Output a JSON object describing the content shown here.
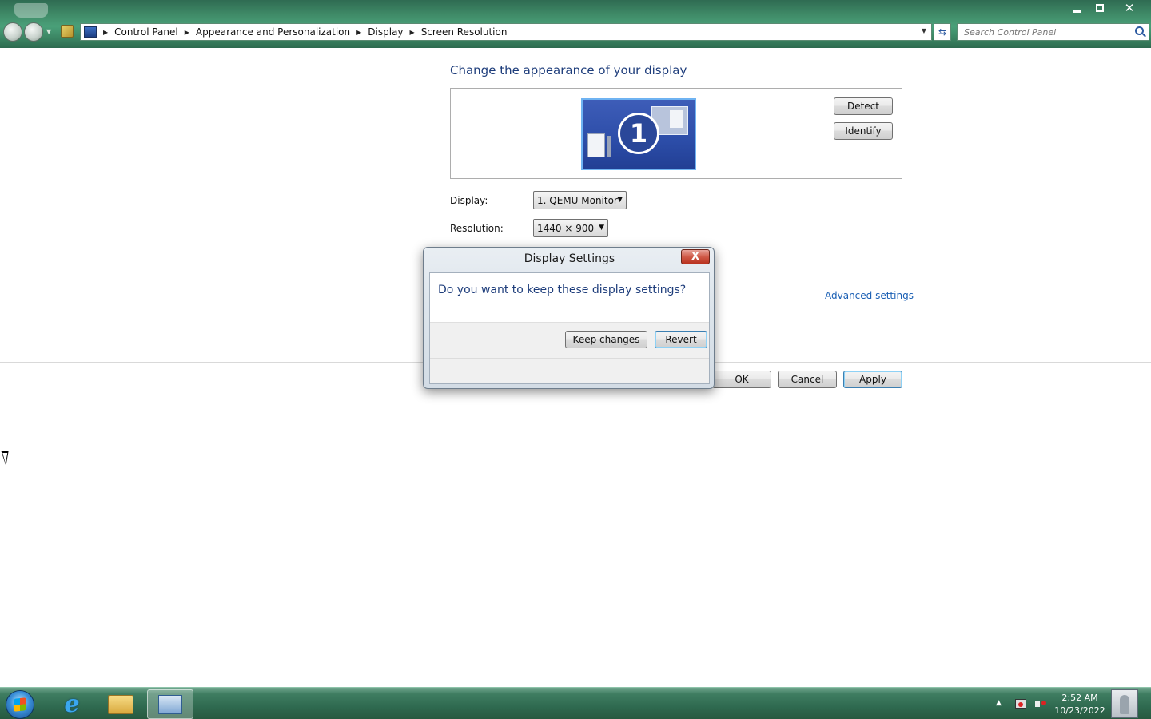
{
  "window": {
    "title": "Screen Resolution",
    "controls": {
      "minimize": "minimize",
      "maximize": "maximize",
      "close": "close"
    }
  },
  "address_bar": {
    "breadcrumbs": [
      "Control Panel",
      "Appearance and Personalization",
      "Display",
      "Screen Resolution"
    ]
  },
  "search": {
    "placeholder": "Search Control Panel"
  },
  "main": {
    "title": "Change the appearance of your display",
    "monitor_number": "1",
    "detect_label": "Detect",
    "identify_label": "Identify",
    "display_label": "Display:",
    "display_value": "1. QEMU Monitor",
    "resolution_label": "Resolution:",
    "resolution_value": "1440 × 900",
    "advanced_link": "Advanced settings",
    "ok_label": "OK",
    "cancel_label": "Cancel",
    "apply_label": "Apply"
  },
  "dialog": {
    "title": "Display Settings",
    "question": "Do you want to keep these display settings?",
    "keep_label": "Keep changes",
    "revert_label": "Revert",
    "close_glyph": "X"
  },
  "taskbar": {
    "pinned": [
      "Internet Explorer",
      "Windows Explorer",
      "Control Panel"
    ],
    "clock_time": "2:52 AM",
    "clock_date": "10/23/2022"
  },
  "colors": {
    "accent_title": "#1e3d7b",
    "link": "#1a5fb4",
    "chrome_green": "#3f8a67",
    "default_button_border": "#3c7fb1"
  }
}
